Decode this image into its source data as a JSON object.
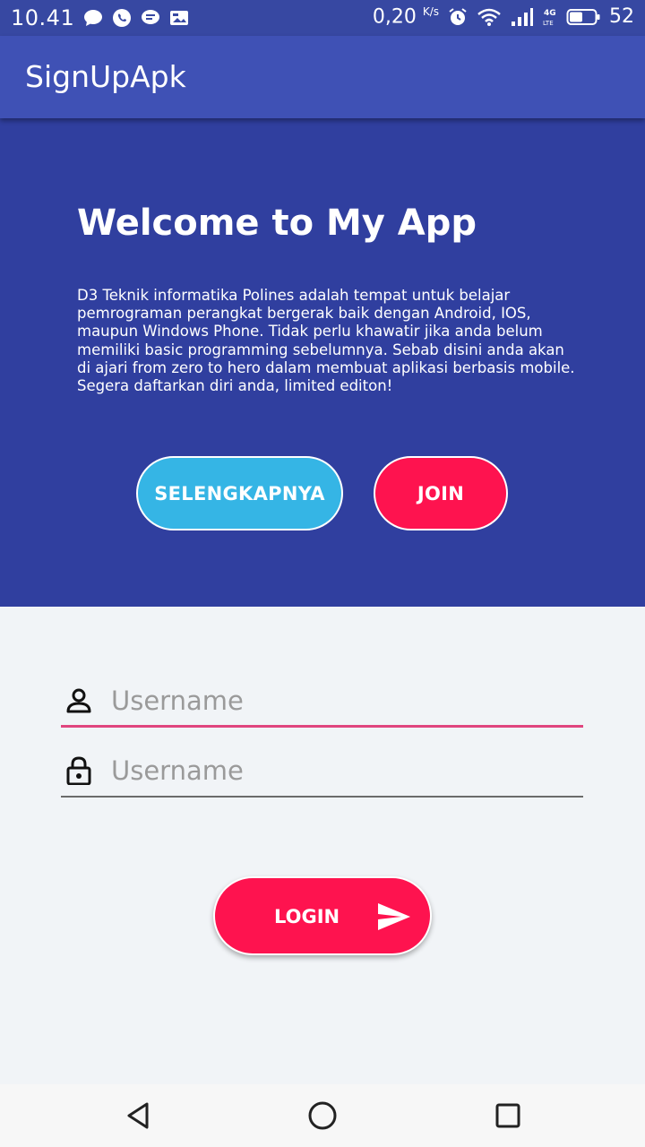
{
  "status_bar": {
    "time": "10.41",
    "net_speed": "0,20",
    "net_unit": "K/s",
    "battery": "52",
    "icons": [
      "chat-bubble-icon",
      "whatsapp-icon",
      "message-icon",
      "image-icon",
      "alarm-icon",
      "wifi-icon",
      "signal-icon",
      "lte-icon",
      "battery-icon"
    ]
  },
  "app_bar": {
    "title": "SignUpApk"
  },
  "hero": {
    "title": "Welcome to My App",
    "description": "D3 Teknik informatika Polines adalah tempat untuk belajar pemrograman perangkat bergerak baik dengan Android, IOS, maupun Windows Phone. Tidak perlu khawatir jika anda belum memiliki basic programming sebelumnya. Sebab disini anda akan di ajari from zero to hero dalam membuat aplikasi berbasis mobile. Segera daftarkan diri anda, limited editon!",
    "more_button": "SELENGKAPNYA",
    "join_button": "JOIN"
  },
  "form": {
    "username_placeholder": "Username",
    "password_placeholder": "Username",
    "login_button": "LOGIN"
  },
  "colors": {
    "status_bar": "#3748a2",
    "app_bar": "#3f51b5",
    "hero_bg": "#303f9f",
    "more_button": "#35b5e5",
    "accent": "#fe134f",
    "focus_underline": "#e0457f",
    "page_bg": "#f1f4f7"
  },
  "nav_bar": {
    "icons": [
      "back-icon",
      "home-icon",
      "recents-icon"
    ]
  }
}
